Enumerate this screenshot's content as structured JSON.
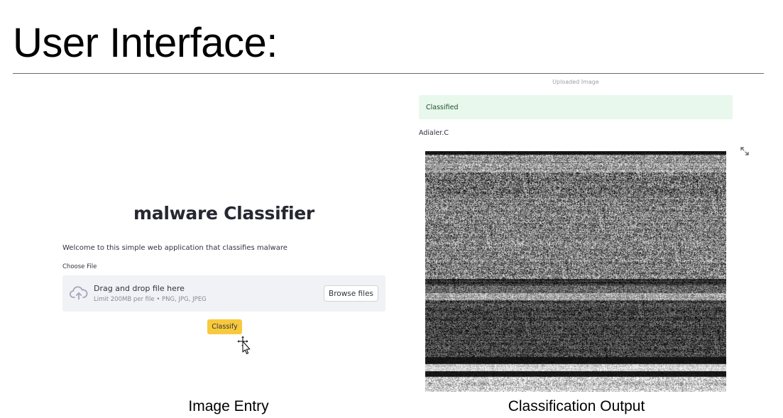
{
  "slide": {
    "title": "User Interface:"
  },
  "left_panel": {
    "app_title": "malware Classifier",
    "welcome_text": "Welcome to this simple web application that classifies malware",
    "file_label": "Choose File",
    "dropzone": {
      "title": "Drag and drop file here",
      "subtitle": "Limit 200MB per file • PNG, JPG, JPEG",
      "icon": "cloud-upload-icon"
    },
    "browse_label": "Browse files",
    "classify_label": "Classify",
    "caption": "Image Entry"
  },
  "right_panel": {
    "image_caption": "Uploaded Image",
    "status_text": "Classified",
    "result_label": "Adialer.C",
    "expand_icon": "expand-icon",
    "caption": "Classification Output"
  },
  "colors": {
    "classify_button": "#f8c93c",
    "success_box": "#e8f8ec",
    "dropzone_bg": "#f0f2f6"
  }
}
